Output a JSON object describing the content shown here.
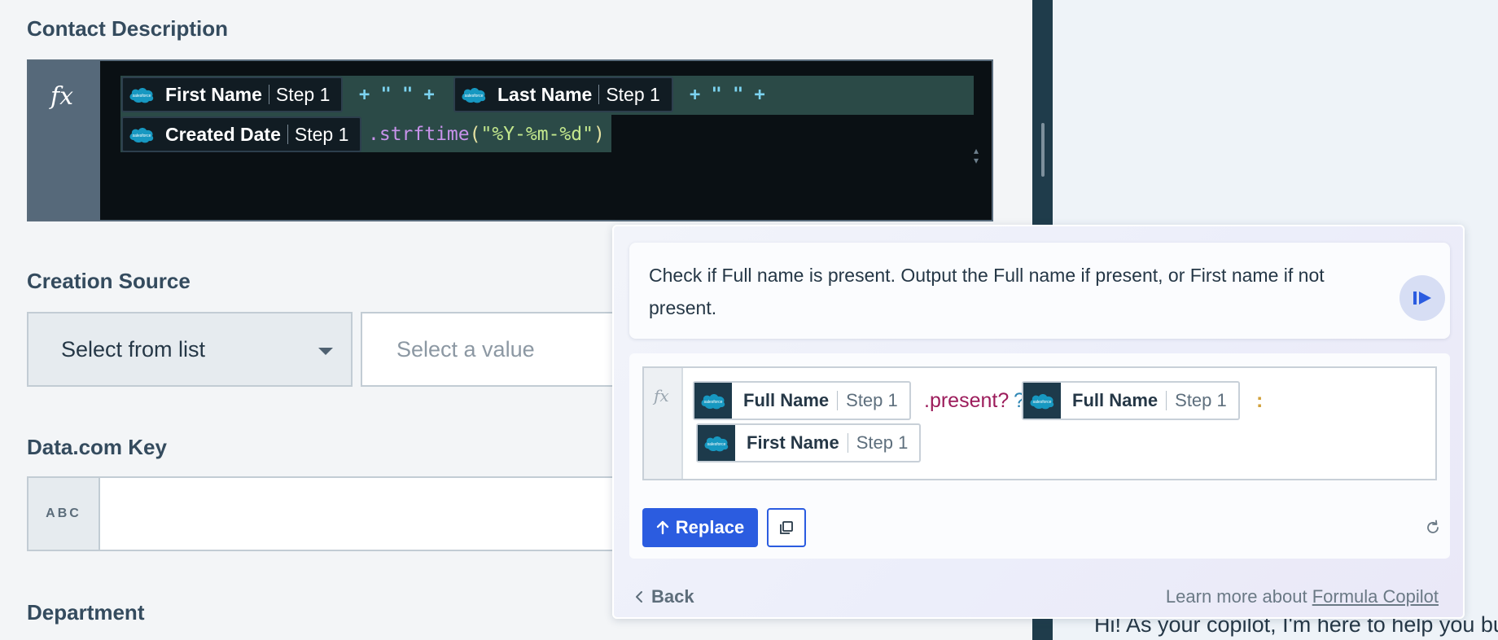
{
  "contact_description": {
    "label": "Contact Description",
    "line1": {
      "pill1": {
        "name": "First Name",
        "step": "Step 1"
      },
      "op1": "+ \" \" +",
      "pill2": {
        "name": "Last Name",
        "step": "Step 1"
      },
      "op2": "+ \" \" +"
    },
    "line2": {
      "pill3": {
        "name": "Created Date",
        "step": "Step 1"
      },
      "method_prefix": ".strftime",
      "paren_open": "(",
      "format_string": "\"%Y-%m-%d\"",
      "paren_close": ")"
    }
  },
  "creation_source": {
    "label": "Creation Source",
    "select_label": "Select from list",
    "value_placeholder": "Select a value"
  },
  "datacom_key": {
    "label": "Data.com Key",
    "type_badge": "ABC"
  },
  "department": {
    "label": "Department"
  },
  "copilot": {
    "prompt": "Check if Full name is present. Output the Full name if present, or First name if not present.",
    "result": {
      "pill1": {
        "name": "Full Name",
        "step": "Step 1"
      },
      "method": ".present?",
      "question": "?",
      "pill2": {
        "name": "Full Name",
        "step": "Step 1"
      },
      "colon": ":",
      "pill3": {
        "name": "First Name",
        "step": "Step 1"
      }
    },
    "replace_label": "Replace",
    "back_label": "Back",
    "learn_more_prefix": "Learn more about",
    "learn_more_link": "Formula Copilot"
  },
  "right_panel": {
    "greeting": "Hi! As your copilot, I'm here to help you bui"
  },
  "colors": {
    "accent": "#2b5ce0",
    "salesforce_blue": "#1798c1",
    "editor_bg": "#0a1014"
  },
  "icons": {
    "formula": "fx-icon",
    "pill_logo": "salesforce-icon",
    "send": "send-icon",
    "replace": "arrow-up-icon",
    "copy": "copy-icon",
    "refresh": "refresh-icon",
    "back": "chevron-left-icon",
    "dropdown": "caret-down-icon"
  }
}
